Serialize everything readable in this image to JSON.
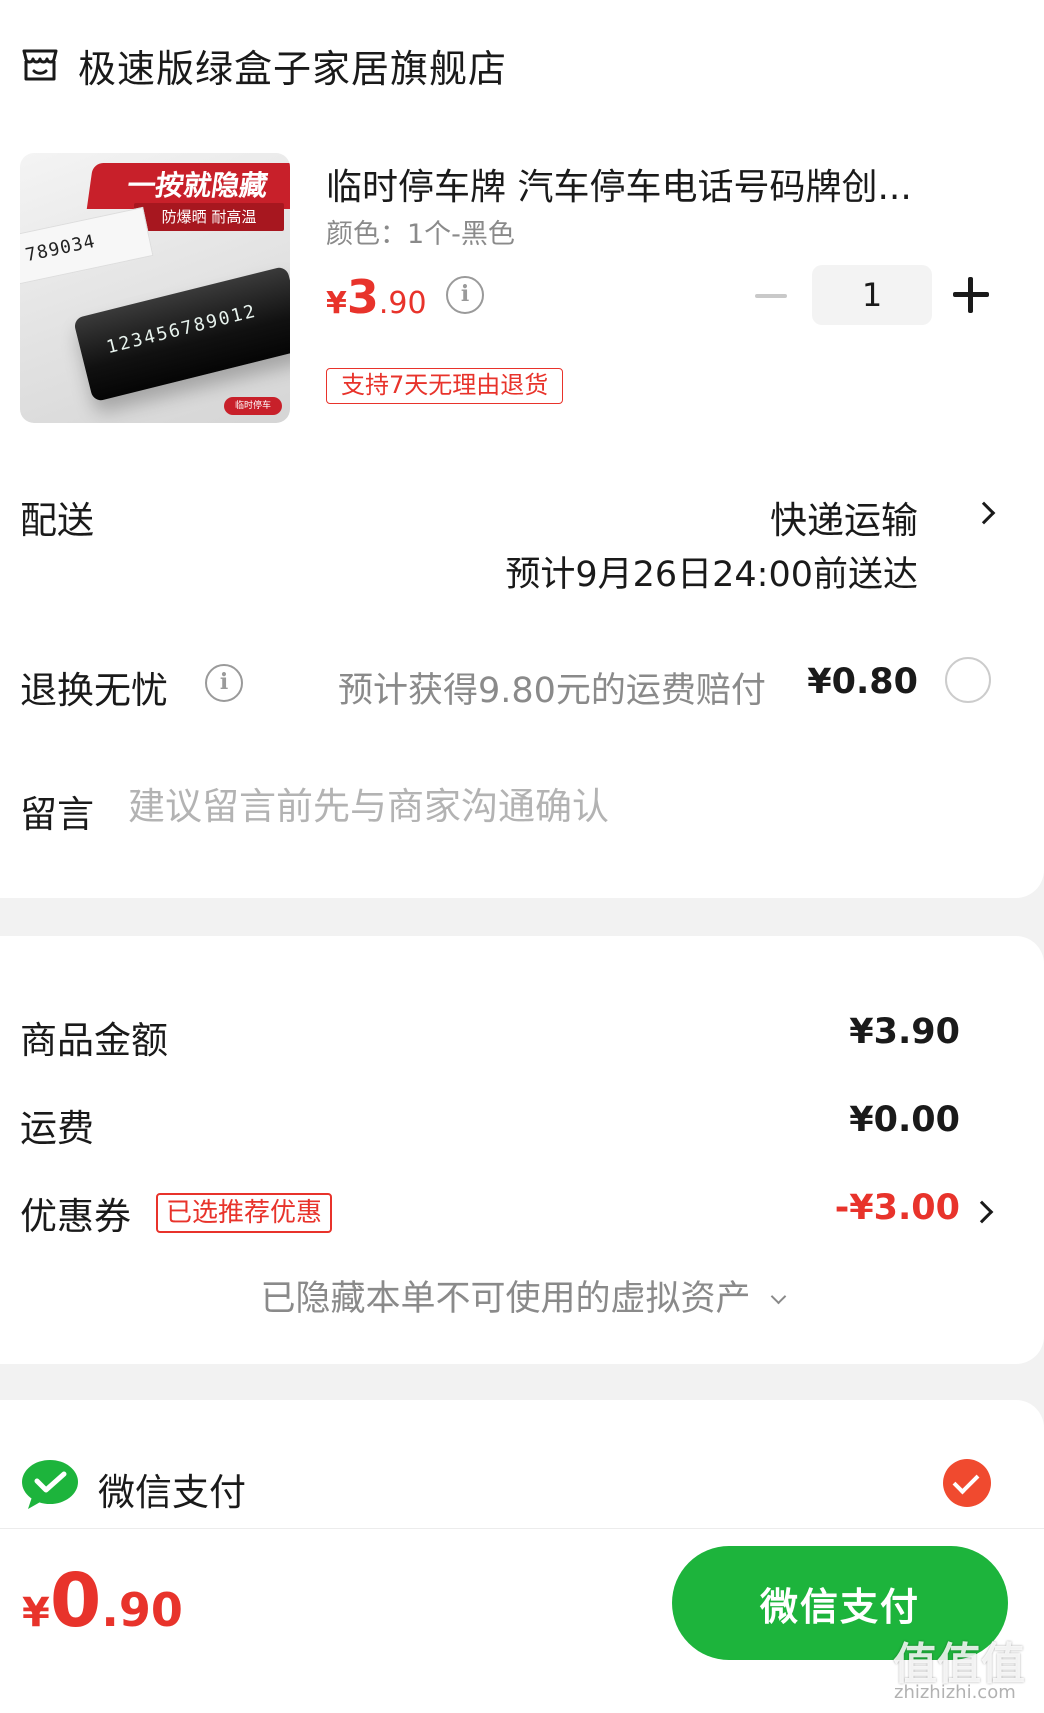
{
  "store": {
    "name": "极速版绿盒子家居旗舰店",
    "icon": "shop-icon"
  },
  "product": {
    "title": "临时停车牌 汽车停车电话号码牌创...",
    "spec": "颜色：1个-黑色",
    "price": {
      "currency": "¥",
      "integer": "3",
      "decimal": ".90"
    },
    "quantity": "1",
    "return_tag": "支持7天无理由退货",
    "image_text": {
      "banner": "一按就隐藏",
      "sub": "防爆晒 耐高温",
      "strip_digits": "789034",
      "device_digits": "123456789012",
      "logo": "临时停车"
    }
  },
  "delivery": {
    "label": "配送",
    "method": "快递运输",
    "eta": "预计9月26日24:00前送达"
  },
  "return_insurance": {
    "label": "退换无忧",
    "description": "预计获得9.80元的运费赔付",
    "price": "¥0.80"
  },
  "message": {
    "label": "留言",
    "placeholder": "建议留言前先与商家沟通确认"
  },
  "summary": {
    "goods_label": "商品金额",
    "goods_value": "¥3.90",
    "shipping_label": "运费",
    "shipping_value": "¥0.00",
    "coupon_label": "优惠券",
    "coupon_tag": "已选推荐优惠",
    "coupon_value": "-¥3.00",
    "hidden_assets": "已隐藏本单不可使用的虚拟资产"
  },
  "payment": {
    "method_label": "微信支付",
    "selected": true
  },
  "footer": {
    "total": {
      "currency": "¥",
      "integer": "0",
      "decimal": ".90"
    },
    "pay_button": "微信支付",
    "watermark": "值值值",
    "watermark_url": "zhizhizhi.com"
  },
  "colors": {
    "accent_red": "#e8332b",
    "wechat_green": "#1db43c"
  }
}
